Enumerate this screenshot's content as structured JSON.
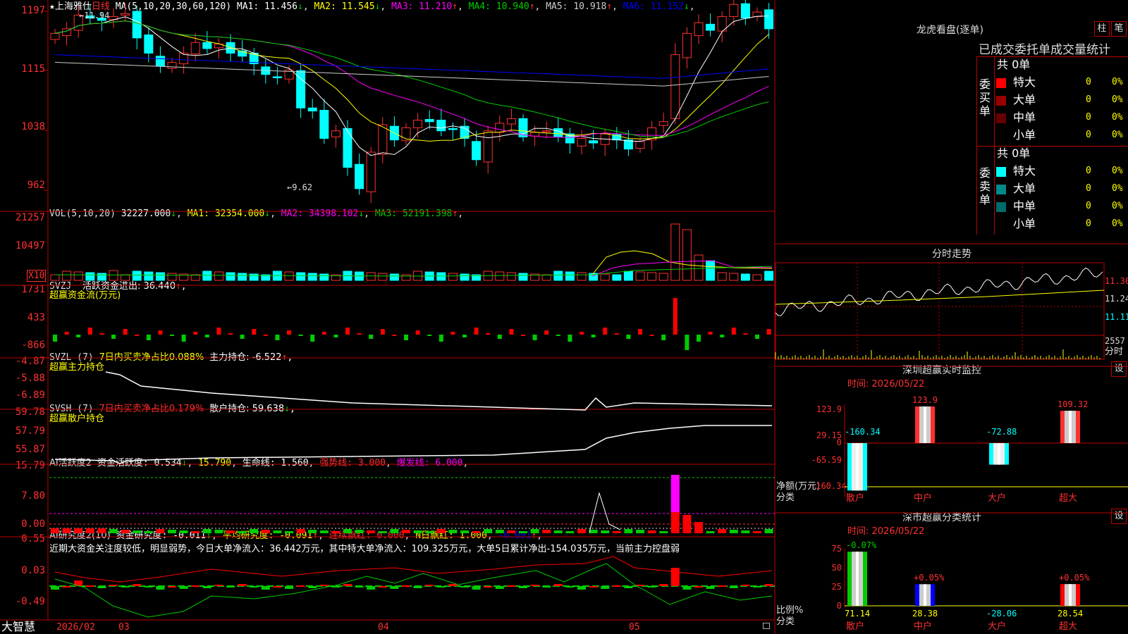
{
  "stock": {
    "star": "★",
    "name": "上海雅仕",
    "period": "日线"
  },
  "main_chart": {
    "ma_header": "MA(5,10,20,30,60,120)",
    "ma": [
      {
        "label": "MA1: 11.456",
        "arrow": "↓",
        "color": "#ffffff"
      },
      {
        "label": "MA2: 11.545",
        "arrow": "↓",
        "color": "#ffff00"
      },
      {
        "label": "MA3: 11.210",
        "arrow": "↑",
        "color": "#ff00ff"
      },
      {
        "label": "MA4: 10.940",
        "arrow": "↑",
        "color": "#00cc00"
      },
      {
        "label": "MA5: 10.918",
        "arrow": "↑",
        "color": "#cccccc"
      },
      {
        "label": "MA6: 11.152",
        "arrow": "↓",
        "color": "#0000ff"
      }
    ],
    "y_ticks": [
      "1197",
      "1115",
      "1038",
      "962"
    ],
    "high_label": "11.94",
    "low_label": "9.62"
  },
  "vol_panel": {
    "header": "VOL(5,10,20)",
    "values": [
      {
        "label": "32227.000",
        "arrow": "↓",
        "color": "#ffffff"
      },
      {
        "label": "MA1: 32354.000",
        "arrow": "↓",
        "color": "#ffff00"
      },
      {
        "label": "MA2: 34398.102",
        "arrow": "↓",
        "color": "#ff00ff"
      },
      {
        "label": "MA3: 52191.398",
        "arrow": "↑",
        "color": "#00cc00"
      }
    ],
    "y_ticks": [
      "21257",
      "10497"
    ],
    "unit": "X10"
  },
  "svzj_panel": {
    "header": "SVZJ",
    "line1": "活跃资金进出: 36.440",
    "arrow": "↑",
    "line2": "超赢资金流(万元)",
    "y_ticks": [
      "1731",
      "433",
      "-866"
    ]
  },
  "svzl_panel": {
    "header": "SVZL (7)",
    "ratio": "7日内买卖净占比0.088%",
    "label": "主力持仓: -6.522",
    "arrow": "↑",
    "line2": "超赢主力持仓",
    "y_ticks": [
      "-4.87",
      "-5.88",
      "-6.89"
    ]
  },
  "svsh_panel": {
    "header": "SVSH (7)",
    "ratio": "7日内买卖净占比0.179%",
    "label": "散户持仓: 59.638",
    "arrow": "↓",
    "line2": "超赢散户持仓",
    "y_ticks": [
      "59.78",
      "57.79",
      "55.87"
    ]
  },
  "ai_active": {
    "header": "AI活跃度2",
    "items": [
      {
        "label": "资金活跃度: 0.534",
        "arrow": "↓",
        "color": "#ffffff"
      },
      {
        "label": "15.790",
        "arrow": "",
        "color": "#ffff00"
      },
      {
        "label": "生命线: 1.560",
        "arrow": "",
        "color": "#ffffff"
      },
      {
        "label": "强势线: 3.000",
        "arrow": "",
        "color": "#ff3030"
      },
      {
        "label": "爆发线: 6.000",
        "arrow": "",
        "color": "#ff00ff"
      }
    ],
    "y_ticks": [
      "15.79",
      "7.80",
      "0.00"
    ]
  },
  "ai_research": {
    "header": "AI研究度2(10)",
    "items": [
      {
        "label": "资金研究度: -0.011",
        "arrow": "↓",
        "color": "#ffffff"
      },
      {
        "label": "平均研究度: -0.091",
        "arrow": "↑",
        "color": "#ffff00"
      },
      {
        "label": "连续飘红: 0.000",
        "arrow": "",
        "color": "#ff3030"
      },
      {
        "label": "N日飘红: 1.000",
        "arrow": "",
        "color": "#ffff00"
      },
      {
        "label": "-0.091",
        "arrow": "↑",
        "color": "#0000ff"
      }
    ],
    "summary": "近期大资金关注度较低，明显弱势，今日大单净流入：36.442万元，其中特大单净流入：109.325万元，大单5日累计净出-154.035万元，当前主力控盘弱",
    "y_ticks": [
      "0.55",
      "0.03",
      "-0.49"
    ]
  },
  "bottom_axis": {
    "logo": "大智慧",
    "labels": [
      "2026/02",
      "03",
      "04",
      "05"
    ]
  },
  "dragon": {
    "title": "龙虎看盘(逐单)",
    "btn_bar": "柱",
    "btn_detail": "笔",
    "subtitle": "已成交委托单成交量统计",
    "buy_label": "委买单",
    "sell_label": "委卖单",
    "buy_total": "共 0单",
    "sell_total": "共 0单",
    "buy_rows": [
      {
        "name": "特大",
        "count": "0",
        "pct": "0%",
        "color": "#ff0000"
      },
      {
        "name": "大单",
        "count": "0",
        "pct": "0%",
        "color": "#990000"
      },
      {
        "name": "中单",
        "count": "0",
        "pct": "0%",
        "color": "#660000"
      },
      {
        "name": "小单",
        "count": "0",
        "pct": "0%",
        "color": "#000000"
      }
    ],
    "sell_rows": [
      {
        "name": "特大",
        "count": "0",
        "pct": "0%",
        "color": "#00ffff"
      },
      {
        "name": "大单",
        "count": "0",
        "pct": "0%",
        "color": "#008b8b"
      },
      {
        "name": "中单",
        "count": "0",
        "pct": "0%",
        "color": "#006b6b"
      },
      {
        "name": "小单",
        "count": "0",
        "pct": "0%",
        "color": "#000000"
      }
    ]
  },
  "intraday": {
    "title": "分时走势",
    "y_ticks": [
      "11.36",
      "11.24",
      "11.11"
    ],
    "vol_tick": "2557",
    "unit": "分时"
  },
  "monitor": {
    "title": "深圳超赢实时监控",
    "settings": "设",
    "time": "时间: 2026/05/22",
    "y_ticks": [
      "123.9",
      "29.15",
      "0",
      "-65.59",
      "-160.34"
    ],
    "y_label1": "净额(万元)",
    "y_label2": "分类",
    "bars": [
      {
        "cat": "散户",
        "value": -160.34,
        "label": "-160.34"
      },
      {
        "cat": "中户",
        "value": 123.9,
        "label": "123.9"
      },
      {
        "cat": "大户",
        "value": -72.88,
        "label": "-72.88"
      },
      {
        "cat": "超大",
        "value": 109.32,
        "label": "109.32"
      }
    ]
  },
  "classify": {
    "title": "深市超赢分类统计",
    "settings": "设",
    "time": "时间: 2026/05/22",
    "y_ticks": [
      "75",
      "50",
      "25",
      "0"
    ],
    "y_label1": "比例%",
    "y_label2": "分类",
    "bars": [
      {
        "cat": "散户",
        "value": 71.14,
        "top_label": "-0.07%",
        "bottom_label": "71.14"
      },
      {
        "cat": "中户",
        "value": 28.38,
        "top_label": "+0.05%",
        "bottom_label": "28.38"
      },
      {
        "cat": "大户",
        "value": 0,
        "top_label": "",
        "bottom_label": "-28.06"
      },
      {
        "cat": "超大",
        "value": 28.54,
        "top_label": "+0.05%",
        "bottom_label": "28.54"
      }
    ]
  }
}
